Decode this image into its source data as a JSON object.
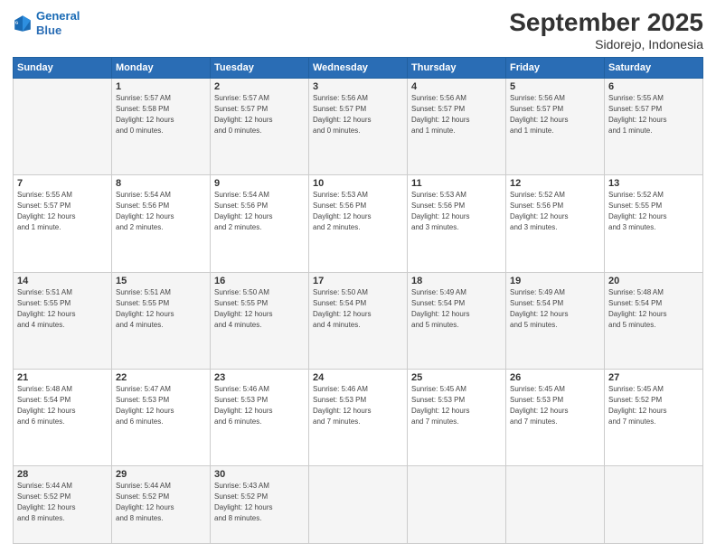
{
  "header": {
    "logo_line1": "General",
    "logo_line2": "Blue",
    "month": "September 2025",
    "location": "Sidorejo, Indonesia"
  },
  "days_of_week": [
    "Sunday",
    "Monday",
    "Tuesday",
    "Wednesday",
    "Thursday",
    "Friday",
    "Saturday"
  ],
  "weeks": [
    [
      {
        "day": "",
        "info": ""
      },
      {
        "day": "1",
        "info": "Sunrise: 5:57 AM\nSunset: 5:58 PM\nDaylight: 12 hours\nand 0 minutes."
      },
      {
        "day": "2",
        "info": "Sunrise: 5:57 AM\nSunset: 5:57 PM\nDaylight: 12 hours\nand 0 minutes."
      },
      {
        "day": "3",
        "info": "Sunrise: 5:56 AM\nSunset: 5:57 PM\nDaylight: 12 hours\nand 0 minutes."
      },
      {
        "day": "4",
        "info": "Sunrise: 5:56 AM\nSunset: 5:57 PM\nDaylight: 12 hours\nand 1 minute."
      },
      {
        "day": "5",
        "info": "Sunrise: 5:56 AM\nSunset: 5:57 PM\nDaylight: 12 hours\nand 1 minute."
      },
      {
        "day": "6",
        "info": "Sunrise: 5:55 AM\nSunset: 5:57 PM\nDaylight: 12 hours\nand 1 minute."
      }
    ],
    [
      {
        "day": "7",
        "info": "Sunrise: 5:55 AM\nSunset: 5:57 PM\nDaylight: 12 hours\nand 1 minute."
      },
      {
        "day": "8",
        "info": "Sunrise: 5:54 AM\nSunset: 5:56 PM\nDaylight: 12 hours\nand 2 minutes."
      },
      {
        "day": "9",
        "info": "Sunrise: 5:54 AM\nSunset: 5:56 PM\nDaylight: 12 hours\nand 2 minutes."
      },
      {
        "day": "10",
        "info": "Sunrise: 5:53 AM\nSunset: 5:56 PM\nDaylight: 12 hours\nand 2 minutes."
      },
      {
        "day": "11",
        "info": "Sunrise: 5:53 AM\nSunset: 5:56 PM\nDaylight: 12 hours\nand 3 minutes."
      },
      {
        "day": "12",
        "info": "Sunrise: 5:52 AM\nSunset: 5:56 PM\nDaylight: 12 hours\nand 3 minutes."
      },
      {
        "day": "13",
        "info": "Sunrise: 5:52 AM\nSunset: 5:55 PM\nDaylight: 12 hours\nand 3 minutes."
      }
    ],
    [
      {
        "day": "14",
        "info": "Sunrise: 5:51 AM\nSunset: 5:55 PM\nDaylight: 12 hours\nand 4 minutes."
      },
      {
        "day": "15",
        "info": "Sunrise: 5:51 AM\nSunset: 5:55 PM\nDaylight: 12 hours\nand 4 minutes."
      },
      {
        "day": "16",
        "info": "Sunrise: 5:50 AM\nSunset: 5:55 PM\nDaylight: 12 hours\nand 4 minutes."
      },
      {
        "day": "17",
        "info": "Sunrise: 5:50 AM\nSunset: 5:54 PM\nDaylight: 12 hours\nand 4 minutes."
      },
      {
        "day": "18",
        "info": "Sunrise: 5:49 AM\nSunset: 5:54 PM\nDaylight: 12 hours\nand 5 minutes."
      },
      {
        "day": "19",
        "info": "Sunrise: 5:49 AM\nSunset: 5:54 PM\nDaylight: 12 hours\nand 5 minutes."
      },
      {
        "day": "20",
        "info": "Sunrise: 5:48 AM\nSunset: 5:54 PM\nDaylight: 12 hours\nand 5 minutes."
      }
    ],
    [
      {
        "day": "21",
        "info": "Sunrise: 5:48 AM\nSunset: 5:54 PM\nDaylight: 12 hours\nand 6 minutes."
      },
      {
        "day": "22",
        "info": "Sunrise: 5:47 AM\nSunset: 5:53 PM\nDaylight: 12 hours\nand 6 minutes."
      },
      {
        "day": "23",
        "info": "Sunrise: 5:46 AM\nSunset: 5:53 PM\nDaylight: 12 hours\nand 6 minutes."
      },
      {
        "day": "24",
        "info": "Sunrise: 5:46 AM\nSunset: 5:53 PM\nDaylight: 12 hours\nand 7 minutes."
      },
      {
        "day": "25",
        "info": "Sunrise: 5:45 AM\nSunset: 5:53 PM\nDaylight: 12 hours\nand 7 minutes."
      },
      {
        "day": "26",
        "info": "Sunrise: 5:45 AM\nSunset: 5:53 PM\nDaylight: 12 hours\nand 7 minutes."
      },
      {
        "day": "27",
        "info": "Sunrise: 5:45 AM\nSunset: 5:52 PM\nDaylight: 12 hours\nand 7 minutes."
      }
    ],
    [
      {
        "day": "28",
        "info": "Sunrise: 5:44 AM\nSunset: 5:52 PM\nDaylight: 12 hours\nand 8 minutes."
      },
      {
        "day": "29",
        "info": "Sunrise: 5:44 AM\nSunset: 5:52 PM\nDaylight: 12 hours\nand 8 minutes."
      },
      {
        "day": "30",
        "info": "Sunrise: 5:43 AM\nSunset: 5:52 PM\nDaylight: 12 hours\nand 8 minutes."
      },
      {
        "day": "",
        "info": ""
      },
      {
        "day": "",
        "info": ""
      },
      {
        "day": "",
        "info": ""
      },
      {
        "day": "",
        "info": ""
      }
    ]
  ]
}
